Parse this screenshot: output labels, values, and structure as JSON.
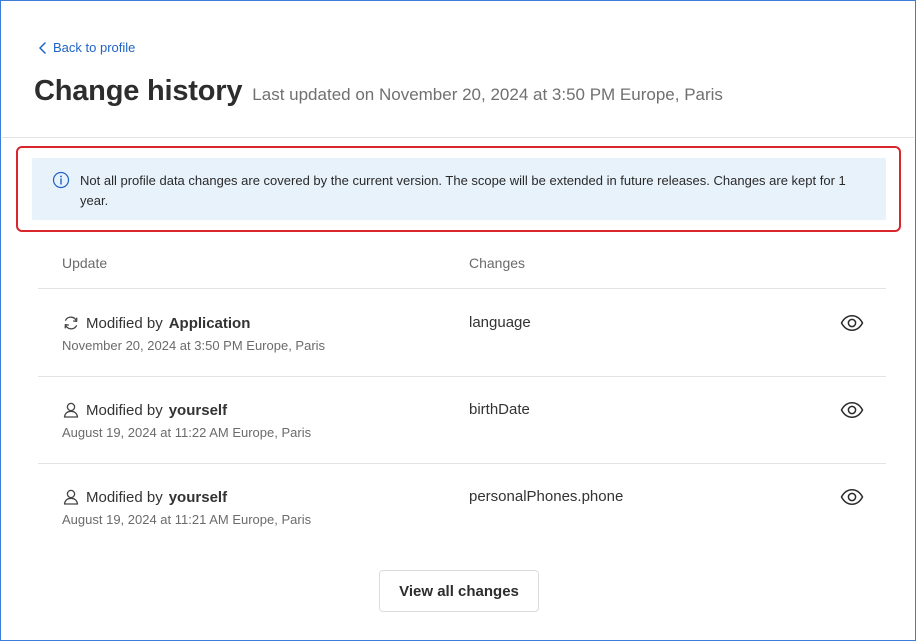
{
  "nav": {
    "back_label": "Back to profile"
  },
  "header": {
    "title": "Change history",
    "last_updated": "Last updated on November 20, 2024 at 3:50 PM Europe, Paris"
  },
  "banner": {
    "icon": "info-icon",
    "message": "Not all profile data changes are covered by the current version. The scope will be extended in future releases. Changes are kept for 1 year."
  },
  "table": {
    "columns": [
      "Update",
      "Changes"
    ],
    "rows": [
      {
        "icon": "sync-icon",
        "prefix": "Modified by",
        "actor": "Application",
        "date": "November 20, 2024 at 3:50 PM Europe, Paris",
        "field": "language"
      },
      {
        "icon": "user-icon",
        "prefix": "Modified by",
        "actor": "yourself",
        "date": "August 19, 2024 at 11:22 AM Europe, Paris",
        "field": "birthDate"
      },
      {
        "icon": "user-icon",
        "prefix": "Modified by",
        "actor": "yourself",
        "date": "August 19, 2024 at 11:21 AM Europe, Paris",
        "field": "personalPhones.phone"
      }
    ]
  },
  "actions": {
    "view_all_label": "View all changes"
  },
  "colors": {
    "link": "#1f63c6",
    "banner_bg": "#e8f2fb",
    "highlight_border": "#d8262c",
    "frame_border": "#3b7dd8"
  }
}
